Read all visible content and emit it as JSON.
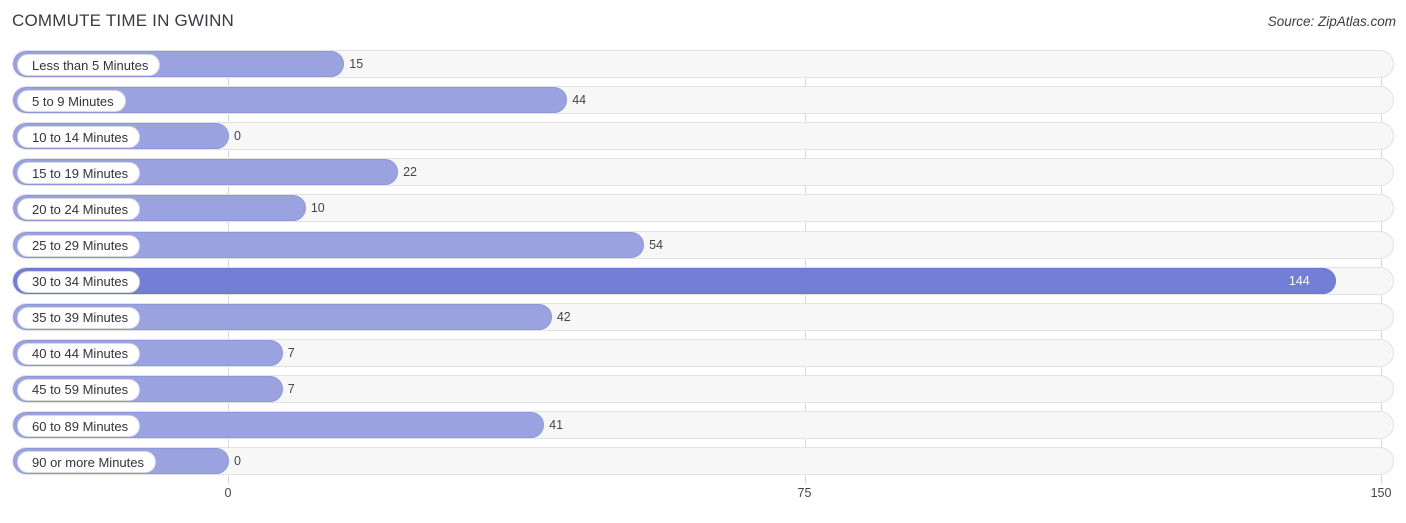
{
  "header": {
    "title": "COMMUTE TIME IN GWINN",
    "source": "Source: ZipAtlas.com"
  },
  "chart_data": {
    "type": "bar",
    "orientation": "horizontal",
    "title": "COMMUTE TIME IN GWINN",
    "xlabel": "",
    "ylabel": "",
    "xlim": [
      0,
      150
    ],
    "ticks": [
      "0",
      "75",
      "150"
    ],
    "tick_values": [
      0,
      75,
      150
    ],
    "grid": true,
    "categories": [
      "Less than 5 Minutes",
      "5 to 9 Minutes",
      "10 to 14 Minutes",
      "15 to 19 Minutes",
      "20 to 24 Minutes",
      "25 to 29 Minutes",
      "30 to 34 Minutes",
      "35 to 39 Minutes",
      "40 to 44 Minutes",
      "45 to 59 Minutes",
      "60 to 89 Minutes",
      "90 or more Minutes"
    ],
    "values": [
      15,
      44,
      0,
      22,
      10,
      54,
      144,
      42,
      7,
      7,
      41,
      0
    ],
    "value_labels": [
      "15",
      "44",
      "0",
      "22",
      "10",
      "54",
      "144",
      "42",
      "7",
      "7",
      "41",
      "0"
    ],
    "colors": {
      "bar": "#9aa3e0",
      "bar_max": "#737fd4",
      "track": "#f7f7f7",
      "grid": "#d8d8dd"
    }
  }
}
